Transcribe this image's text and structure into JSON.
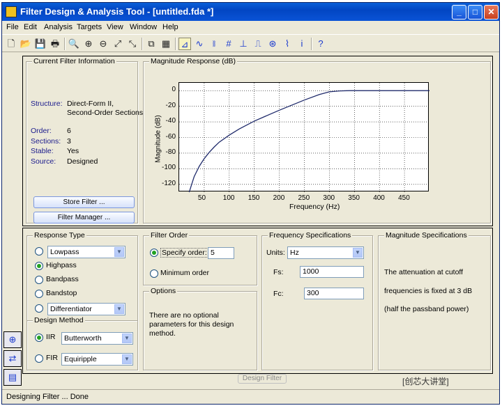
{
  "window": {
    "title": "Filter Design & Analysis Tool - [untitled.fda *]",
    "controls": {
      "minimize": "_",
      "maximize": "□",
      "close": "✕"
    }
  },
  "menu": [
    "File",
    "Edit",
    "Analysis",
    "Targets",
    "View",
    "Window",
    "Help"
  ],
  "toolbar": {
    "icons": [
      "new-icon",
      "open-icon",
      "save-icon",
      "print-icon",
      "print-preview-icon",
      "zoom-in-icon",
      "zoom-x-icon",
      "zoom-y-icon",
      "full-view-icon",
      "new-figure-icon",
      "design-filter-icon",
      "magnitude-icon",
      "phase-icon",
      "mag-phase-icon",
      "group-delay-icon",
      "impulse-icon",
      "step-icon",
      "pole-zero-icon",
      "coefficients-icon",
      "info-icon",
      "whats-this-icon"
    ],
    "glyphs": [
      "🗋",
      "📂",
      "💾",
      "🖶",
      "🔍",
      "⊕",
      "⊖",
      "⤢",
      "⤡",
      "⧉",
      "▦",
      "⊿",
      "∿",
      "⧚",
      "#",
      "⊥",
      "⎍",
      "⊛",
      "⌇",
      "i",
      "?"
    ],
    "pressed_index": 11
  },
  "current_filter": {
    "title": "Current Filter Information",
    "structure_label": "Structure:",
    "structure_value_1": "Direct-Form II,",
    "structure_value_2": "Second-Order Sections",
    "order_label": "Order:",
    "order_value": "6",
    "sections_label": "Sections:",
    "sections_value": "3",
    "stable_label": "Stable:",
    "stable_value": "Yes",
    "source_label": "Source:",
    "source_value": "Designed",
    "store_button": "Store Filter ...",
    "manager_button": "Filter Manager ..."
  },
  "chart_panel_title": "Magnitude Response (dB)",
  "chart_data": {
    "type": "line",
    "title": "Magnitude Response (dB)",
    "xlabel": "Frequency (Hz)",
    "ylabel": "Magnitude (dB)",
    "xlim": [
      0,
      500
    ],
    "ylim": [
      -130,
      10
    ],
    "xticks": [
      50,
      100,
      150,
      200,
      250,
      300,
      350,
      400,
      450
    ],
    "yticks": [
      0,
      -20,
      -40,
      -60,
      -80,
      -100,
      -120
    ],
    "grid": true,
    "series": [
      {
        "color": "#1f2a6b",
        "x": [
          20,
          25,
          30,
          40,
          50,
          60,
          70,
          80,
          100,
          120,
          150,
          200,
          250,
          280,
          300,
          320,
          340,
          350,
          400,
          450,
          500
        ],
        "y": [
          -130,
          -120,
          -110,
          -97,
          -87,
          -79,
          -72,
          -66,
          -57,
          -49,
          -39,
          -25,
          -12,
          -5,
          -1.5,
          -0.3,
          0,
          0,
          0,
          0,
          0
        ]
      }
    ]
  },
  "response_type": {
    "title": "Response Type",
    "lowpass": "Lowpass",
    "highpass": "Highpass",
    "bandpass": "Bandpass",
    "bandstop": "Bandstop",
    "differentiator": "Differentiator",
    "selected": "Highpass"
  },
  "design_method": {
    "title": "Design Method",
    "iir_label": "IIR",
    "iir_value": "Butterworth",
    "fir_label": "FIR",
    "fir_value": "Equiripple",
    "selected": "IIR"
  },
  "filter_order": {
    "title": "Filter Order",
    "specify_label": "Specify order:",
    "specify_value": "5",
    "minimum_label": "Minimum order",
    "selected": "Specify order"
  },
  "options": {
    "title": "Options",
    "text_1": "There are no optional",
    "text_2": "parameters for this design",
    "text_3": "method."
  },
  "freq_specs": {
    "title": "Frequency Specifications",
    "units_label": "Units:",
    "units_value": "Hz",
    "fs_label": "Fs:",
    "fs_value": "1000",
    "fc_label": "Fc:",
    "fc_value": "300"
  },
  "mag_specs": {
    "title": "Magnitude Specifications",
    "text_1": "The attenuation at cutoff",
    "text_2": "frequencies is fixed at 3 dB",
    "text_3": "(half the passband power)"
  },
  "design_button": "Design Filter",
  "status": "Designing Filter ... Done",
  "watermark": "[创芯大讲堂]"
}
